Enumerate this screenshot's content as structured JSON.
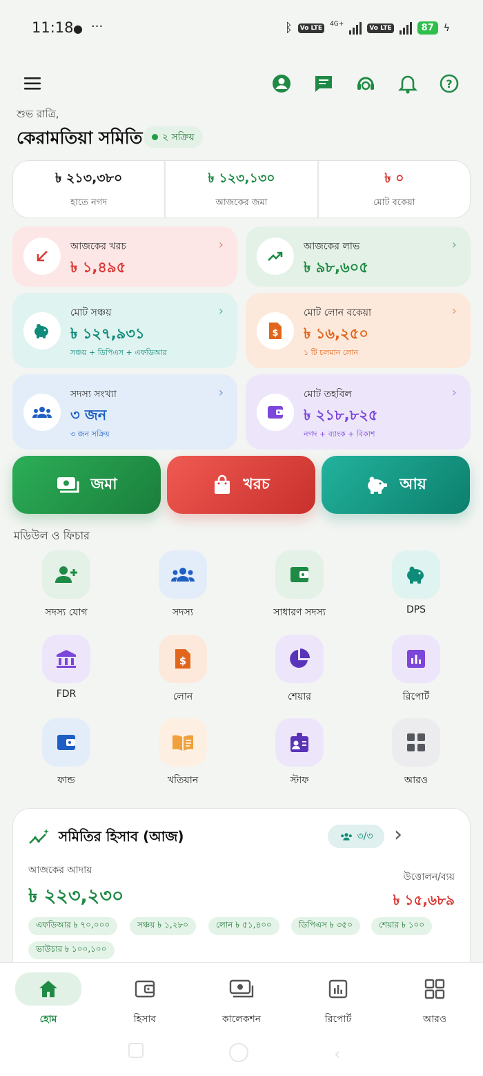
{
  "status_bar": {
    "time": "11:18",
    "network": "4G+",
    "volte": "Vo LTE",
    "battery": "87"
  },
  "header": {
    "greeting": "শুভ রাত্রি,",
    "org_name": "কেরামতিয়া সমিতি",
    "active_badge": "২ সক্রিয়"
  },
  "summary": [
    {
      "value": "৳ ২১৩,৩৮০",
      "label": "হাতে নগদ",
      "color": "#1b1b1b"
    },
    {
      "value": "৳ ১২৩,১৩০",
      "label": "আজকের জমা",
      "color": "#1f8a45"
    },
    {
      "value": "৳ ০",
      "label": "মোট বকেয়া",
      "color": "#d93a35"
    }
  ],
  "cards": {
    "expense": {
      "title": "আজকের খরচ",
      "value": "৳ ১,৪৯৫",
      "color": "#d93a35",
      "bg": "#fde6e6"
    },
    "profit": {
      "title": "আজকের লাভ",
      "value": "৳ ৯৮,৬০৫",
      "color": "#1f8a45",
      "bg": "#e3f1e6"
    },
    "savings": {
      "title": "মোট সঞ্চয়",
      "value": "৳ ১২৭,৯৩১",
      "sub": "সঞ্চয় + ডিপিএস + এফডিআর",
      "color": "#0f8b79",
      "bg": "#dff3f0"
    },
    "loan": {
      "title": "মোট লোন বকেয়া",
      "value": "৳ ১৬,২৫০",
      "sub": "১ টি চলমান লোন",
      "color": "#e0661c",
      "bg": "#fde9dc"
    },
    "members": {
      "title": "সদস্য সংখ্যা",
      "value": "৩ জন",
      "sub": "৩ জন সক্রিয়",
      "color": "#1f5fc4",
      "bg": "#e3edf9"
    },
    "fund": {
      "title": "মোট তহবিল",
      "value": "৳ ২১৮,৮২৫",
      "sub": "নগদ + ব্যাংক + বিকাশ",
      "color": "#7b46d9",
      "bg": "#ede6fb"
    }
  },
  "actions": {
    "deposit": "জমা",
    "expense": "খরচ",
    "income": "আয়"
  },
  "modules_title": "মডিউল ও ফিচার",
  "modules": [
    {
      "label": "সদস্য যোগ",
      "icon": "add-member-icon"
    },
    {
      "label": "সদস্য",
      "icon": "members-icon"
    },
    {
      "label": "সাধারণ সদস্য",
      "icon": "wallet-icon"
    },
    {
      "label": "DPS",
      "icon": "piggy-bank-icon"
    },
    {
      "label": "FDR",
      "icon": "bank-icon"
    },
    {
      "label": "লোন",
      "icon": "loan-document-icon"
    },
    {
      "label": "শেয়ার",
      "icon": "pie-chart-icon"
    },
    {
      "label": "রিপোর্ট",
      "icon": "bar-chart-icon"
    },
    {
      "label": "ফান্ড",
      "icon": "fund-wallet-icon"
    },
    {
      "label": "খতিয়ান",
      "icon": "ledger-book-icon"
    },
    {
      "label": "স্টাফ",
      "icon": "staff-badge-icon"
    },
    {
      "label": "আরও",
      "icon": "grid-icon"
    }
  ],
  "account": {
    "title": "সমিতির হিসাব (আজ)",
    "member_badge": "৩/৩",
    "collection_label": "আজকের আদায়",
    "collection_value": "৳ ২২৩,২৩০",
    "withdraw_label": "উত্তোলন/ব্যয়",
    "withdraw_value": "৳ ১৫,৬৮৯",
    "chips": [
      "এফডিআর ৳ ৭০,০০০",
      "সঞ্চয় ৳ ১,২৮০",
      "লোন ৳ ৫১,৪০০",
      "ডিপিএস ৳ ৩৫০",
      "শেয়ার ৳ ১০০",
      "ভাউচার ৳ ১০০,১০০"
    ]
  },
  "nav": [
    {
      "label": "হোম",
      "icon": "home-icon",
      "active": true
    },
    {
      "label": "হিসাব",
      "icon": "wallet-icon"
    },
    {
      "label": "কালেকশন",
      "icon": "cash-icon"
    },
    {
      "label": "রিপোর্ট",
      "icon": "report-icon"
    },
    {
      "label": "আরও",
      "icon": "grid-icon"
    }
  ],
  "colors": {
    "primary": "#1f8a45",
    "danger": "#d93a35",
    "teal": "#0f8b79"
  }
}
